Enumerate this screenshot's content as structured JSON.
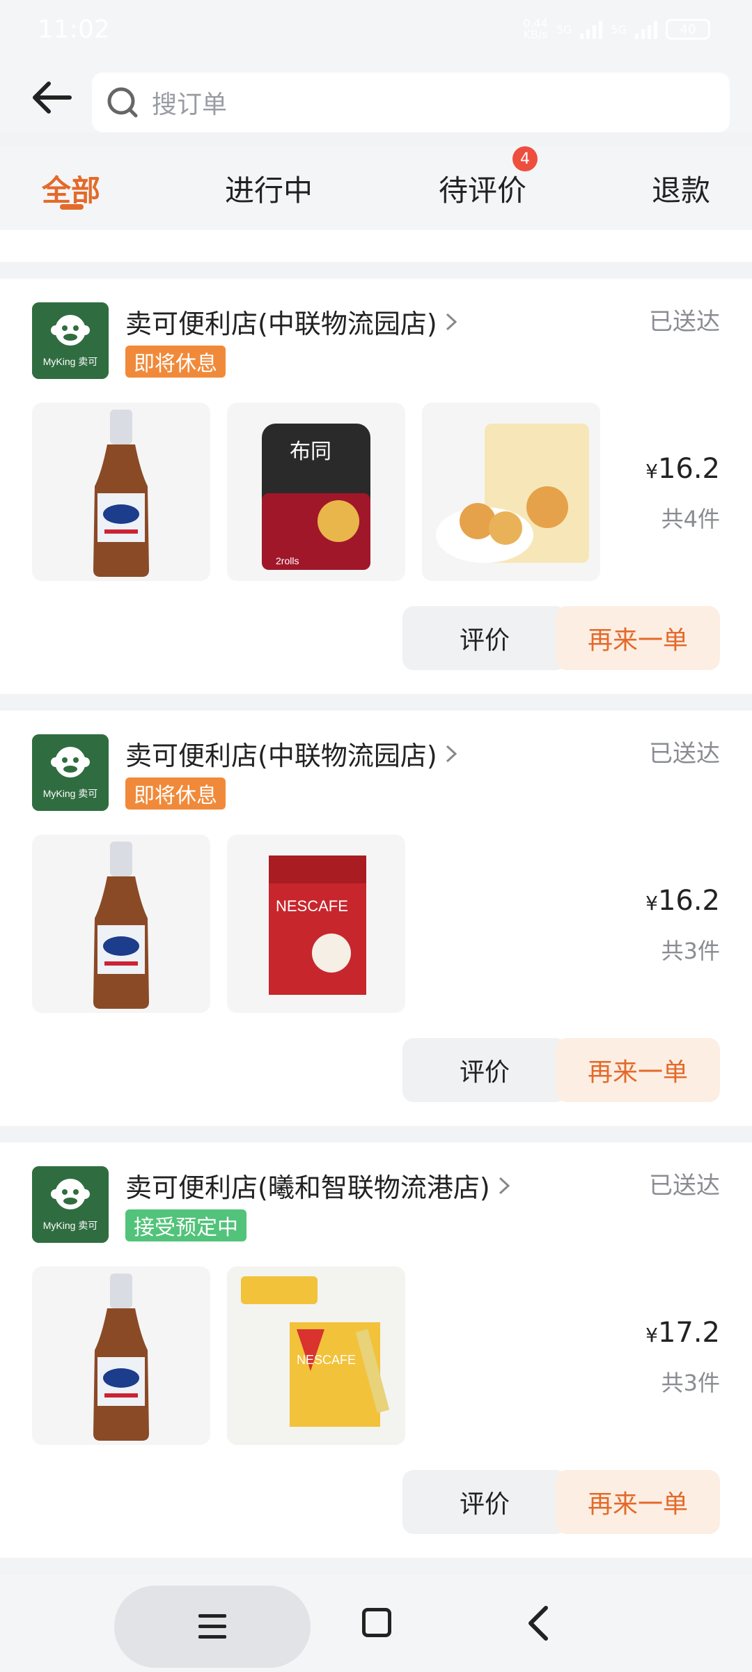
{
  "status_bar": {
    "time": "11:02",
    "net_speed_top": "0.44",
    "net_speed_bottom": "KB/s",
    "signal1": "5G",
    "signal2": "5G",
    "battery": "40"
  },
  "search": {
    "placeholder": "搜订单"
  },
  "tabs": {
    "items": [
      {
        "label": "全部"
      },
      {
        "label": "进行中"
      },
      {
        "label": "待评价",
        "badge": "4"
      },
      {
        "label": "退款"
      }
    ]
  },
  "orders": [
    {
      "store_name": "卖可便利店(中联物流园店)",
      "logo_text": "MyKing 卖可",
      "status": "已送达",
      "tag": "即将休息",
      "tag_color": "#f08a3a",
      "products": [
        "Pabst Blue Ribbon beer bottle",
        "布同 BUTONG roll paper 2rolls",
        "Cake buns pack"
      ],
      "price_symbol": "¥",
      "price": "16.2",
      "qty": "共4件",
      "review_label": "评价",
      "reorder_label": "再来一单"
    },
    {
      "store_name": "卖可便利店(中联物流园店)",
      "logo_text": "MyKing 卖可",
      "status": "已送达",
      "tag": "即将休息",
      "tag_color": "#f08a3a",
      "products": [
        "Pabst Blue Ribbon beer bottle",
        "Nescafe 1+2 coffee box"
      ],
      "price_symbol": "¥",
      "price": "16.2",
      "qty": "共3件",
      "review_label": "评价",
      "reorder_label": "再来一单"
    },
    {
      "store_name": "卖可便利店(曦和智联物流港店)",
      "logo_text": "MyKing 卖可",
      "status": "已送达",
      "tag": "接受预定中",
      "tag_color": "#52c37a",
      "products": [
        "Pabst Blue Ribbon beer bottle",
        "Nescafe yellow promo box"
      ],
      "price_symbol": "¥",
      "price": "17.2",
      "qty": "共3件",
      "review_label": "评价",
      "reorder_label": "再来一单"
    }
  ],
  "colors": {
    "accent": "#e36a2a",
    "badge": "#ee4e3e",
    "logo_bg": "#2f6d41"
  }
}
